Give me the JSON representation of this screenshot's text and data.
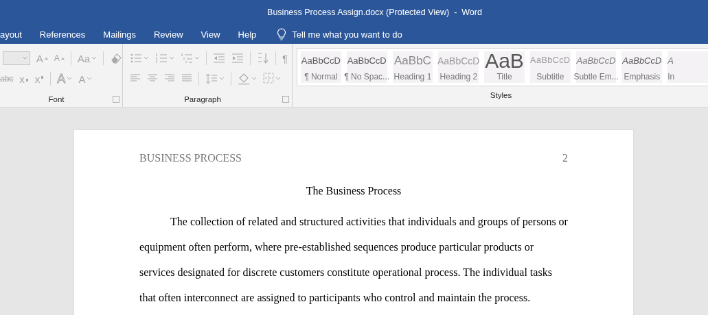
{
  "window": {
    "title": "Business Process Assign.docx (Protected View)  -  Word"
  },
  "tabs": [
    {
      "label": "ayout",
      "selected": false
    },
    {
      "label": "References",
      "selected": false
    },
    {
      "label": "Mailings",
      "selected": false
    },
    {
      "label": "Review",
      "selected": false
    },
    {
      "label": "View",
      "selected": false
    },
    {
      "label": "Help",
      "selected": false
    }
  ],
  "tell_me": {
    "placeholder": "Tell me what you want to do"
  },
  "ribbon": {
    "disabled": true,
    "font_group": {
      "label": "Font",
      "rows": [
        {
          "buttons": [
            {
              "kind": "field"
            },
            {
              "kind": "grow",
              "text": "A"
            },
            {
              "kind": "shrink",
              "text": "A"
            },
            {
              "kind": "sep"
            },
            {
              "kind": "text",
              "text": "Aa",
              "dropdown": true
            },
            {
              "kind": "sep"
            },
            {
              "kind": "eraser"
            }
          ]
        },
        {
          "buttons": [
            {
              "kind": "strike",
              "text": "abc"
            },
            {
              "kind": "sub",
              "text": "x"
            },
            {
              "kind": "sup",
              "text": "x"
            },
            {
              "kind": "sep"
            },
            {
              "kind": "outline",
              "text": "A",
              "dropdown": true
            },
            {
              "kind": "color",
              "text": "A",
              "dropdown": true
            }
          ]
        }
      ]
    },
    "paragraph_group": {
      "label": "Paragraph",
      "rows": [
        {
          "buttons": [
            {
              "kind": "bullets",
              "dropdown": true
            },
            {
              "kind": "numbering",
              "dropdown": true
            },
            {
              "kind": "multilevel",
              "dropdown": true
            },
            {
              "kind": "sep"
            },
            {
              "kind": "outdent"
            },
            {
              "kind": "indent"
            },
            {
              "kind": "sep"
            },
            {
              "kind": "sort"
            },
            {
              "kind": "sep"
            },
            {
              "kind": "marks",
              "text": "¶"
            }
          ]
        },
        {
          "buttons": [
            {
              "kind": "align-left"
            },
            {
              "kind": "align-center"
            },
            {
              "kind": "align-right"
            },
            {
              "kind": "justify"
            },
            {
              "kind": "sep"
            },
            {
              "kind": "spacing",
              "dropdown": true
            },
            {
              "kind": "sep"
            },
            {
              "kind": "shading",
              "dropdown": true
            },
            {
              "kind": "borders",
              "dropdown": true
            }
          ]
        }
      ]
    },
    "styles": {
      "label": "Styles",
      "items": [
        {
          "preview": "AaBbCcD",
          "name": "¶ Normal",
          "kind": "normal"
        },
        {
          "preview": "AaBbCcD",
          "name": "¶ No Spac...",
          "kind": "normal"
        },
        {
          "preview": "AaBbC",
          "name": "Heading 1",
          "kind": "heading1"
        },
        {
          "preview": "AaBbCcD",
          "name": "Heading 2",
          "kind": "heading2"
        },
        {
          "preview": "AaB",
          "name": "Title",
          "kind": "title"
        },
        {
          "preview": "AaBbCcD",
          "name": "Subtitle",
          "kind": "subtitle"
        },
        {
          "preview": "AaBbCcD",
          "name": "Subtle Em...",
          "kind": "italic"
        },
        {
          "preview": "AaBbCcD",
          "name": "Emphasis",
          "kind": "emphasis"
        },
        {
          "preview": "A",
          "name": "In",
          "kind": "italic"
        }
      ]
    }
  },
  "document": {
    "header": "BUSINESS PROCESS",
    "page_number": "2",
    "title": "The Business Process",
    "paragraphs": [
      "The collection of related and structured activities that individuals and groups of persons or equipment often perform, where pre-established sequences produce particular products or services designated for discrete customers constitute operational process. The individual tasks that often interconnect are assigned to participants who control and maintain the process."
    ]
  }
}
